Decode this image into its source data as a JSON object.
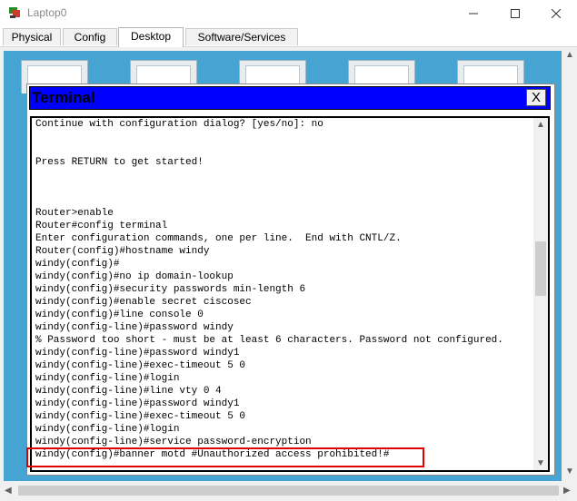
{
  "window": {
    "title": "Laptop0",
    "icon": "laptop-app-icon",
    "controls": [
      "minimize-icon",
      "maximize-icon",
      "close-icon"
    ]
  },
  "tabs": [
    {
      "label": "Physical",
      "active": false
    },
    {
      "label": "Config",
      "active": false
    },
    {
      "label": "Desktop",
      "active": true
    },
    {
      "label": "Software/Services",
      "active": false
    }
  ],
  "terminal": {
    "title": "Terminal",
    "close_label": "X",
    "lines": [
      "Continue with configuration dialog? [yes/no]: no",
      "",
      "",
      "Press RETURN to get started!",
      "",
      "",
      "",
      "Router>enable",
      "Router#config terminal",
      "Enter configuration commands, one per line.  End with CNTL/Z.",
      "Router(config)#hostname windy",
      "windy(config)#",
      "windy(config)#no ip domain-lookup",
      "windy(config)#security passwords min-length 6",
      "windy(config)#enable secret ciscosec",
      "windy(config)#line console 0",
      "windy(config-line)#password windy",
      "% Password too short - must be at least 6 characters. Password not configured.",
      "windy(config-line)#password windy1",
      "windy(config-line)#exec-timeout 5 0",
      "windy(config-line)#login",
      "windy(config-line)#line vty 0 4",
      "windy(config-line)#password windy1",
      "windy(config-line)#exec-timeout 5 0",
      "windy(config-line)#login",
      "windy(config-line)#service password-encryption",
      "windy(config)#banner motd #Unauthorized access prohibited!#"
    ]
  },
  "colors": {
    "terminal_header": "#0000ff",
    "desktop_background": "#46a4d3",
    "highlight_box": "#e00000"
  }
}
